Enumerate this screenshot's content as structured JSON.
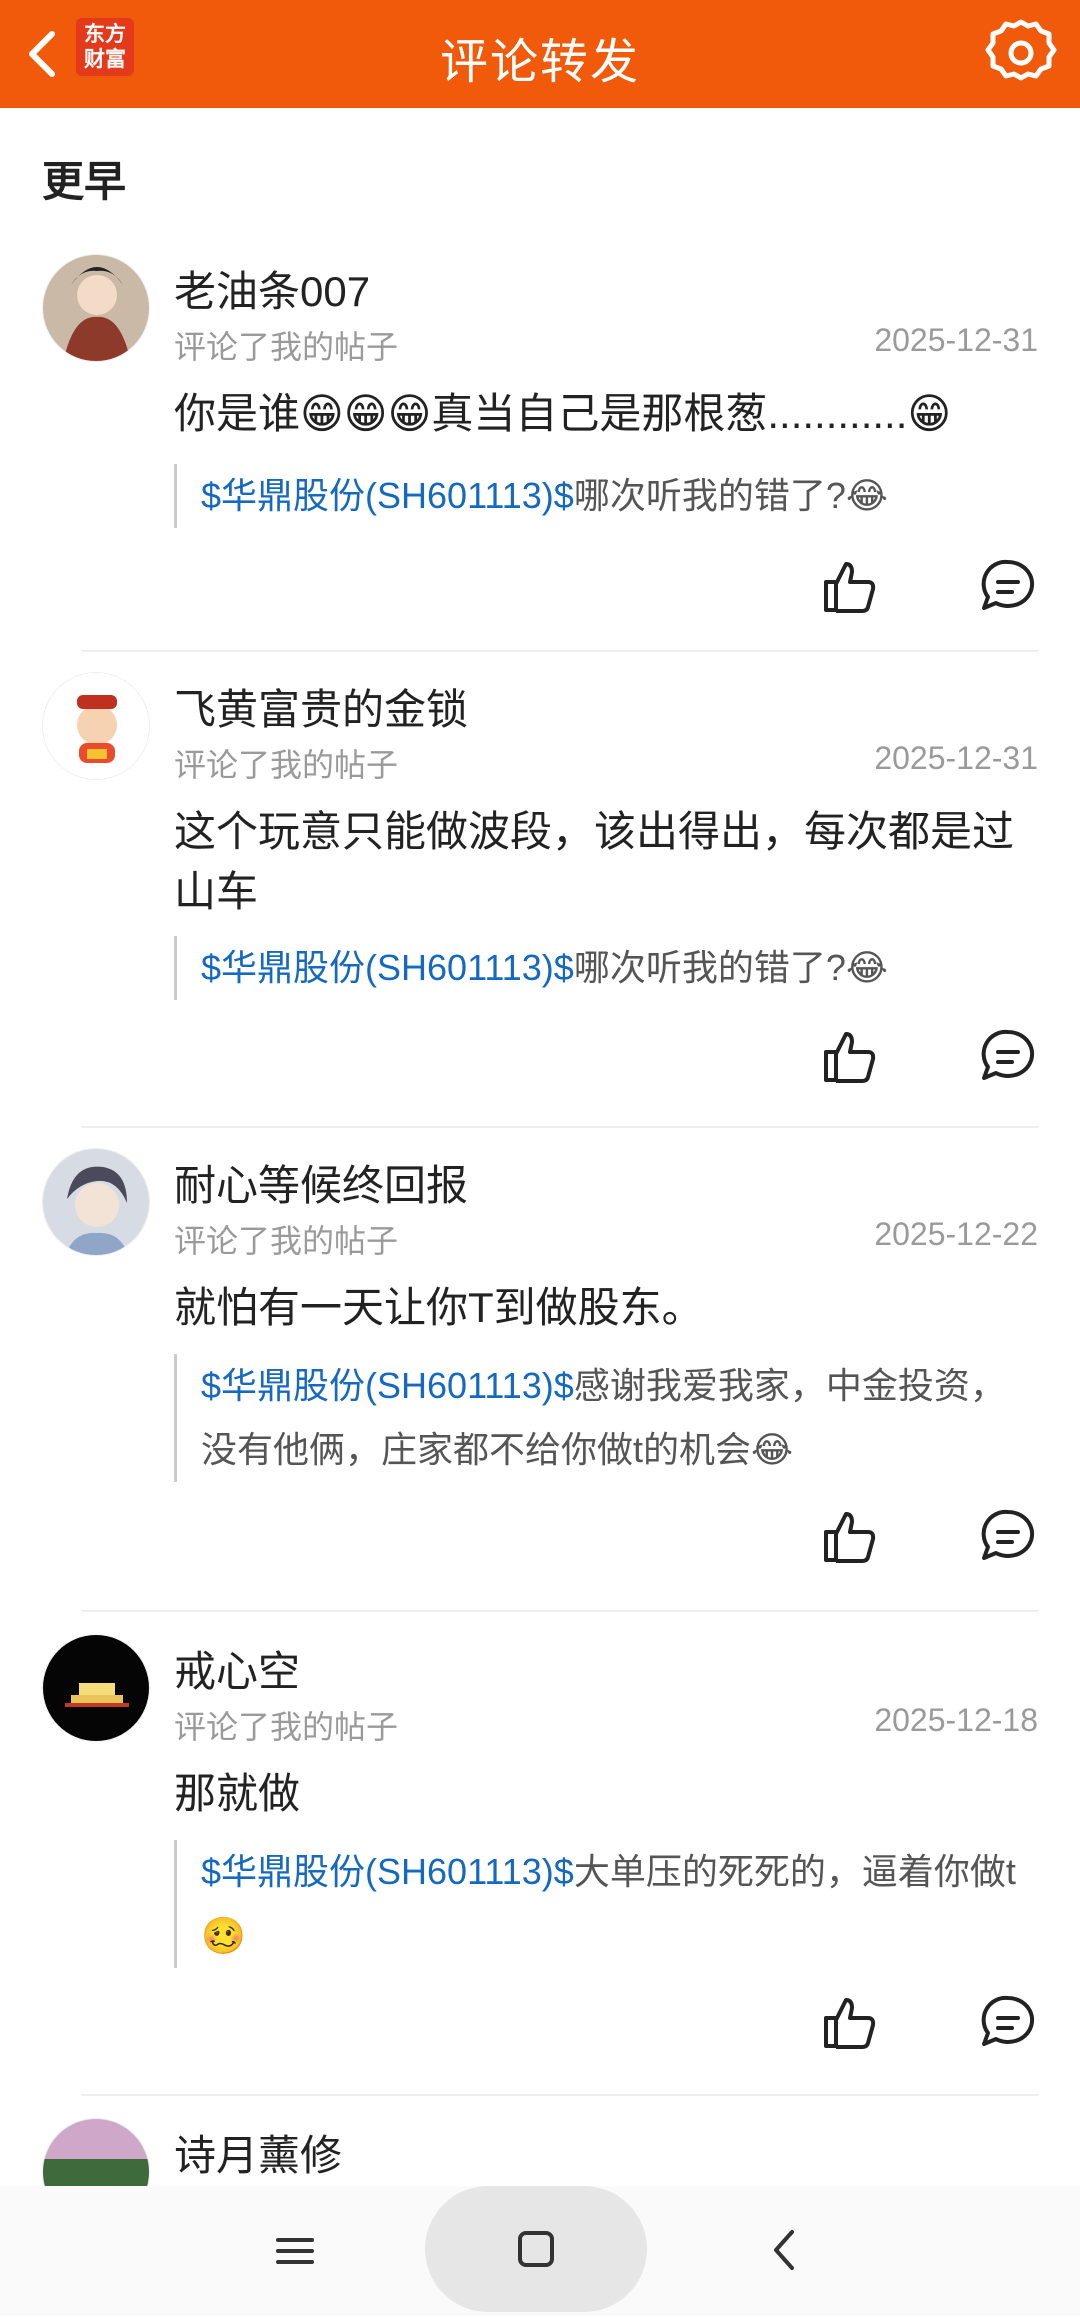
{
  "header": {
    "title": "评论转发",
    "logo_line1": "东方",
    "logo_line2": "财富"
  },
  "section_title": "更早",
  "items": [
    {
      "username": "老油条007",
      "action": "评论了我的帖子",
      "date": "2025-12-31",
      "comment": "你是谁😁😁😁真当自己是那根葱............😁",
      "quote_stock": "$华鼎股份(SH601113)$",
      "quote_text": "哪次听我的错了?😂"
    },
    {
      "username": "飞黄富贵的金锁",
      "action": "评论了我的帖子",
      "date": "2025-12-31",
      "comment": "这个玩意只能做波段，该出得出，每次都是过山车",
      "quote_stock": "$华鼎股份(SH601113)$",
      "quote_text": "哪次听我的错了?😂"
    },
    {
      "username": "耐心等候终回报",
      "action": "评论了我的帖子",
      "date": "2025-12-22",
      "comment": "就怕有一天让你T到做股东。",
      "quote_stock": "$华鼎股份(SH601113)$",
      "quote_text": "感谢我爱我家，中金投资，没有他俩，庄家都不给你做t的机会😂"
    },
    {
      "username": "戒心空",
      "action": "评论了我的帖子",
      "date": "2025-12-18",
      "comment": "那就做",
      "quote_stock": "$华鼎股份(SH601113)$",
      "quote_text": "大单压的死死的，逼着你做t🥴"
    },
    {
      "username": "诗月薰修"
    }
  ],
  "colors": {
    "topbar": "#f05a0a",
    "stock_link": "#1669c1",
    "secondary_text": "#9a9a9a"
  },
  "icons": {
    "back": "chevron-left-icon",
    "settings": "gear-icon",
    "like": "thumbs-up-icon",
    "reply": "comment-bubble-icon"
  }
}
